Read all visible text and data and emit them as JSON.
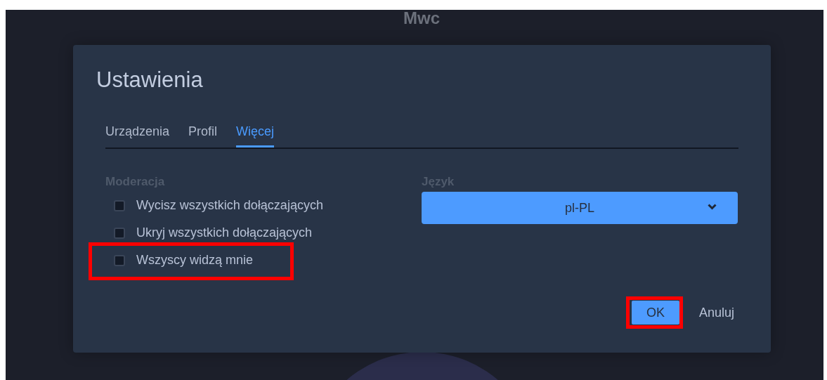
{
  "app_title": "Mwc",
  "dialog": {
    "title": "Ustawienia",
    "tabs": [
      {
        "label": "Urządzenia",
        "selected": false
      },
      {
        "label": "Profil",
        "selected": false
      },
      {
        "label": "Więcej",
        "selected": true
      }
    ],
    "moderation": {
      "heading": "Moderacja",
      "options": [
        {
          "label": "Wycisz wszystkich dołączających",
          "checked": false,
          "highlighted": false
        },
        {
          "label": "Ukryj wszystkich dołączających",
          "checked": false,
          "highlighted": false
        },
        {
          "label": "Wszyscy widzą mnie",
          "checked": false,
          "highlighted": true
        }
      ]
    },
    "language": {
      "label": "Język",
      "value": "pl-PL"
    },
    "buttons": [
      {
        "label": "OK",
        "kind": "primary",
        "highlighted": true
      },
      {
        "label": "Anuluj",
        "kind": "text",
        "highlighted": false
      }
    ]
  }
}
